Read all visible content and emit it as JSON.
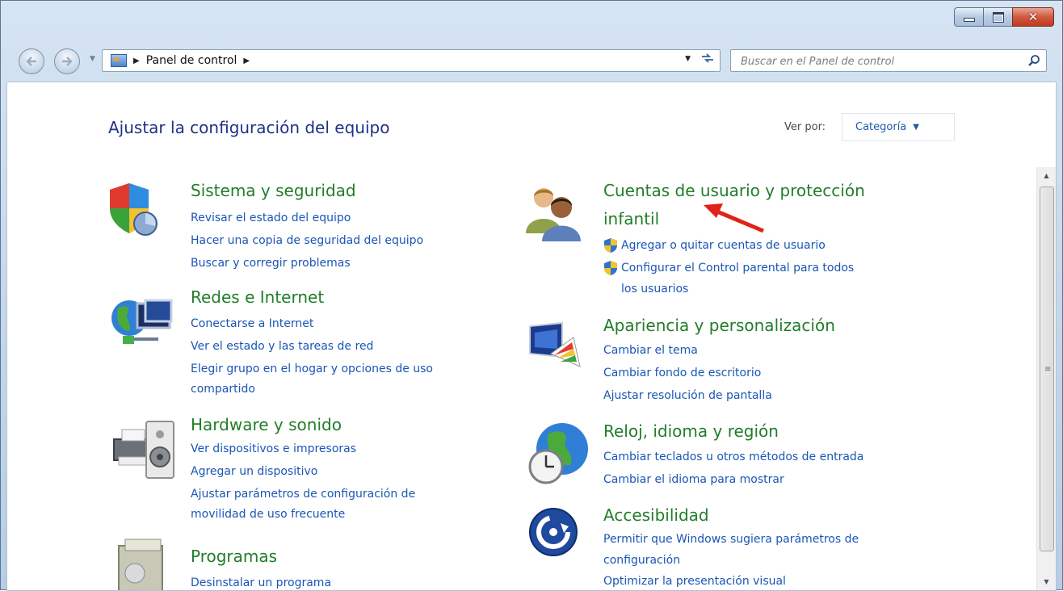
{
  "window": {
    "caption": {
      "minimize": "minimize-icon",
      "maximize": "maximize-icon",
      "close": "close-icon",
      "close_glyph": "✕"
    }
  },
  "nav": {
    "back": "back-arrow-icon",
    "forward": "forward-arrow-icon",
    "breadcrumb": [
      "Panel de control"
    ],
    "search_placeholder": "Buscar en el Panel de control"
  },
  "header": {
    "title": "Ajustar la configuración del equipo",
    "view_by_label": "Ver por:",
    "view_by_value": "Categoría"
  },
  "categories": {
    "sistema": {
      "title": "Sistema y seguridad",
      "icon": "security-shield-icon",
      "links": [
        "Revisar el estado del equipo",
        "Hacer una copia de seguridad del equipo",
        "Buscar y corregir problemas"
      ]
    },
    "redes": {
      "title": "Redes e Internet",
      "icon": "network-globe-icon",
      "links": [
        "Conectarse a Internet",
        "Ver el estado y las tareas de red",
        "Elegir grupo en el hogar y opciones de uso",
        "compartido"
      ]
    },
    "hardware": {
      "title": "Hardware y sonido",
      "icon": "printer-speaker-icon",
      "links": [
        "Ver dispositivos e impresoras",
        "Agregar un dispositivo",
        "Ajustar parámetros de configuración de",
        "movilidad de uso frecuente"
      ]
    },
    "programas": {
      "title": "Programas",
      "icon": "programs-box-icon",
      "links": [
        "Desinstalar un programa"
      ]
    },
    "cuentas": {
      "title_line1": "Cuentas de usuario y protección",
      "title_line2": "infantil",
      "icon": "users-icon",
      "links": [
        "Agregar o quitar cuentas de usuario",
        "Configurar el Control parental para todos",
        "los usuarios"
      ]
    },
    "apariencia": {
      "title": "Apariencia y personalización",
      "icon": "monitor-palette-icon",
      "links": [
        "Cambiar el tema",
        "Cambiar fondo de escritorio",
        "Ajustar resolución de pantalla"
      ]
    },
    "reloj": {
      "title": "Reloj, idioma y región",
      "icon": "globe-clock-icon",
      "links": [
        "Cambiar teclados u otros métodos de entrada",
        "Cambiar el idioma para mostrar"
      ]
    },
    "accesibilidad": {
      "title": "Accesibilidad",
      "icon": "accessibility-icon",
      "links": [
        "Permitir que Windows sugiera parámetros de",
        "configuración",
        "Optimizar la presentación visual"
      ]
    }
  },
  "annotation": {
    "arrow_color": "#e0231a"
  }
}
